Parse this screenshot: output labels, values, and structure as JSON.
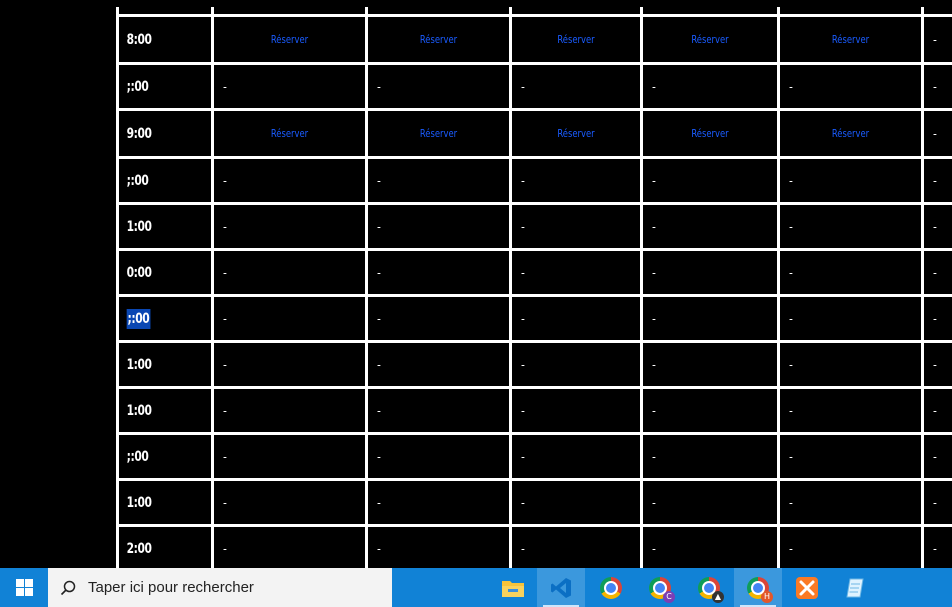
{
  "schedule": {
    "rows": [
      {
        "time": "8:00",
        "reserve": true
      },
      {
        "time": ";:00",
        "reserve": false
      },
      {
        "time": "9:00",
        "reserve": true
      },
      {
        "time": ";:00",
        "reserve": false
      },
      {
        "time": "1:00",
        "reserve": false
      },
      {
        "time": "0:00",
        "reserve": false
      },
      {
        "time": ";:00",
        "reserve": false,
        "selected": true
      },
      {
        "time": "1:00",
        "reserve": false
      },
      {
        "time": "1:00",
        "reserve": false
      },
      {
        "time": ";:00",
        "reserve": false
      },
      {
        "time": "1:00",
        "reserve": false
      },
      {
        "time": "2:00",
        "reserve": false
      }
    ],
    "reserve_label": "Réserver",
    "empty_label": "-",
    "day_count": 6
  },
  "taskbar": {
    "search_placeholder": "Taper ici pour rechercher",
    "apps": [
      {
        "name": "file-explorer-icon",
        "active": false,
        "label": ""
      },
      {
        "name": "vscode-icon",
        "active": true,
        "label": ""
      },
      {
        "name": "chrome-icon",
        "active": false,
        "label": ""
      },
      {
        "name": "chrome-profile-c-icon",
        "active": false,
        "label": "C"
      },
      {
        "name": "chrome-profile-cursor-icon",
        "active": false,
        "label": ""
      },
      {
        "name": "chrome-profile-h-icon",
        "active": true,
        "label": "H"
      },
      {
        "name": "xampp-icon",
        "active": false,
        "label": ""
      },
      {
        "name": "notepad-icon",
        "active": false,
        "label": ""
      }
    ]
  },
  "colors": {
    "reserve_link": "#1a5cff",
    "selection": "#0a47b3",
    "taskbar": "#1182d6"
  }
}
